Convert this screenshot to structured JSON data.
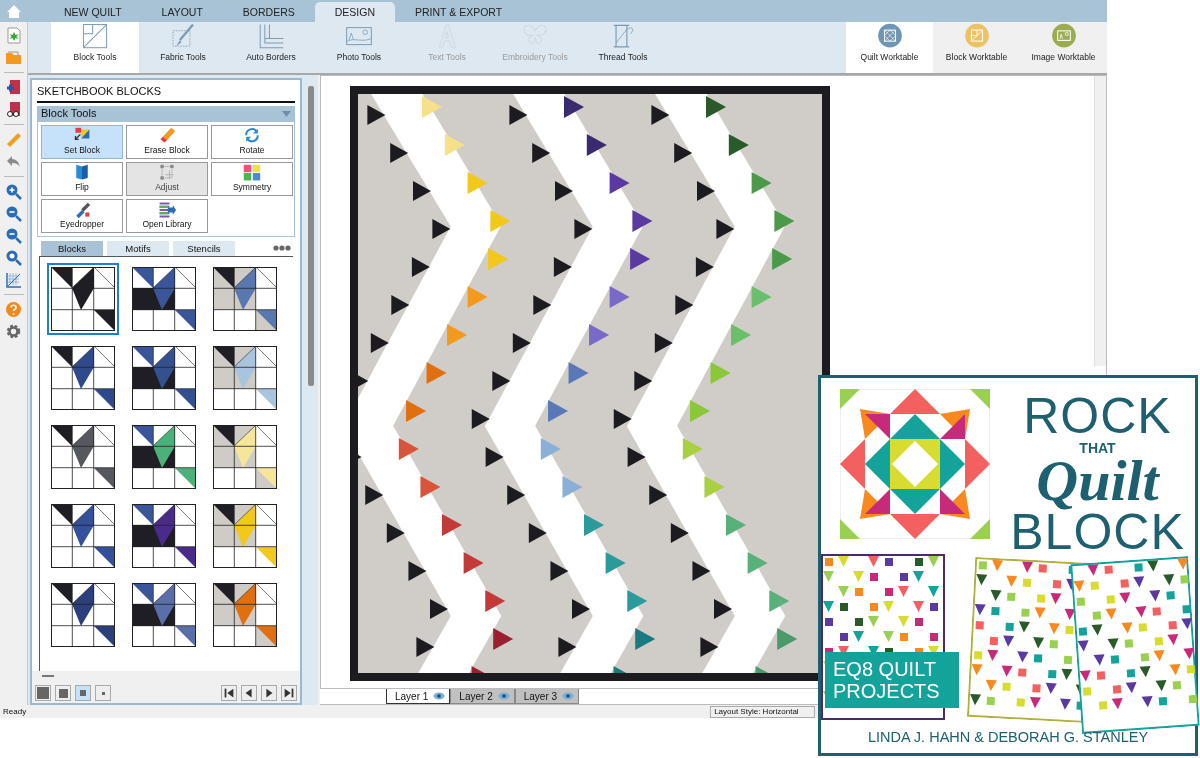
{
  "top_tabs": [
    {
      "label": "NEW QUILT",
      "selected": false
    },
    {
      "label": "LAYOUT",
      "selected": false
    },
    {
      "label": "BORDERS",
      "selected": false
    },
    {
      "label": "DESIGN",
      "selected": true
    },
    {
      "label": "PRINT & EXPORT",
      "selected": false
    }
  ],
  "ribbon": {
    "tools": [
      {
        "label": "Block Tools",
        "selected": true,
        "disabled": false
      },
      {
        "label": "Fabric Tools",
        "selected": false,
        "disabled": false
      },
      {
        "label": "Auto Borders",
        "selected": false,
        "disabled": false
      },
      {
        "label": "Photo Tools",
        "selected": false,
        "disabled": false
      },
      {
        "label": "Text Tools",
        "selected": false,
        "disabled": true
      },
      {
        "label": "Embroidery Tools",
        "selected": false,
        "disabled": true
      },
      {
        "label": "Thread Tools",
        "selected": false,
        "disabled": false
      }
    ],
    "worktables": [
      {
        "label": "Quilt Worktable",
        "selected": true
      },
      {
        "label": "Block Worktable",
        "selected": false
      },
      {
        "label": "Image Worktable",
        "selected": false
      }
    ]
  },
  "sketchbook": {
    "title": "SKETCHBOOK BLOCKS",
    "section": "Block Tools",
    "expanded": true,
    "tools": [
      {
        "label": "Set Block",
        "selected": true,
        "disabled": false
      },
      {
        "label": "Erase Block",
        "selected": false,
        "disabled": false
      },
      {
        "label": "Rotate",
        "selected": false,
        "disabled": false
      },
      {
        "label": "Flip",
        "selected": false,
        "disabled": false
      },
      {
        "label": "Adjust",
        "selected": false,
        "disabled": true
      },
      {
        "label": "Symmetry",
        "selected": false,
        "disabled": false
      },
      {
        "label": "Eyedropper",
        "selected": false,
        "disabled": false
      },
      {
        "label": "Open Library",
        "selected": false,
        "disabled": false
      }
    ],
    "tabs": [
      {
        "label": "Blocks",
        "selected": true
      },
      {
        "label": "Motifs",
        "selected": false
      },
      {
        "label": "Stencils",
        "selected": false
      }
    ],
    "blocks": [
      {
        "color": "#1e1e24",
        "selected": true
      },
      {
        "color": "#3a559a",
        "selected": false
      },
      {
        "color": "#5a78b0",
        "selected": false
      },
      {
        "color": "#2f4a8a",
        "selected": false
      },
      {
        "color": "#34508f",
        "selected": false
      },
      {
        "color": "#a9c4de",
        "selected": false
      },
      {
        "color": "#55585e",
        "selected": false
      },
      {
        "color": "#4bb07a",
        "selected": false
      },
      {
        "color": "#f6e69a",
        "selected": false
      },
      {
        "color": "#35509a",
        "selected": false
      },
      {
        "color": "#4a2a8a",
        "selected": false
      },
      {
        "color": "#f2c81a",
        "selected": false
      },
      {
        "color": "#2c3f7a",
        "selected": false
      },
      {
        "color": "#5a6fa8",
        "selected": false
      },
      {
        "color": "#e0700f",
        "selected": false
      }
    ],
    "thumb_sizes": [
      {
        "selected": false
      },
      {
        "selected": false
      },
      {
        "selected": true
      },
      {
        "selected": false
      }
    ]
  },
  "layers": [
    {
      "label": "Layer 1",
      "selected": true
    },
    {
      "label": "Layer 2",
      "selected": false
    },
    {
      "label": "Layer 3",
      "selected": false
    }
  ],
  "status_bar": {
    "left": "Ready",
    "right": "Layout Style: Horizontal"
  },
  "book_cover": {
    "title_lines": [
      "ROCK",
      "THAT",
      "Quilt",
      "BLOCK"
    ],
    "badge_lines": [
      "EQ8 QUILT",
      "PROJECTS"
    ],
    "authors": "LINDA J. HAHN & DEBORAH G. STANLEY"
  }
}
